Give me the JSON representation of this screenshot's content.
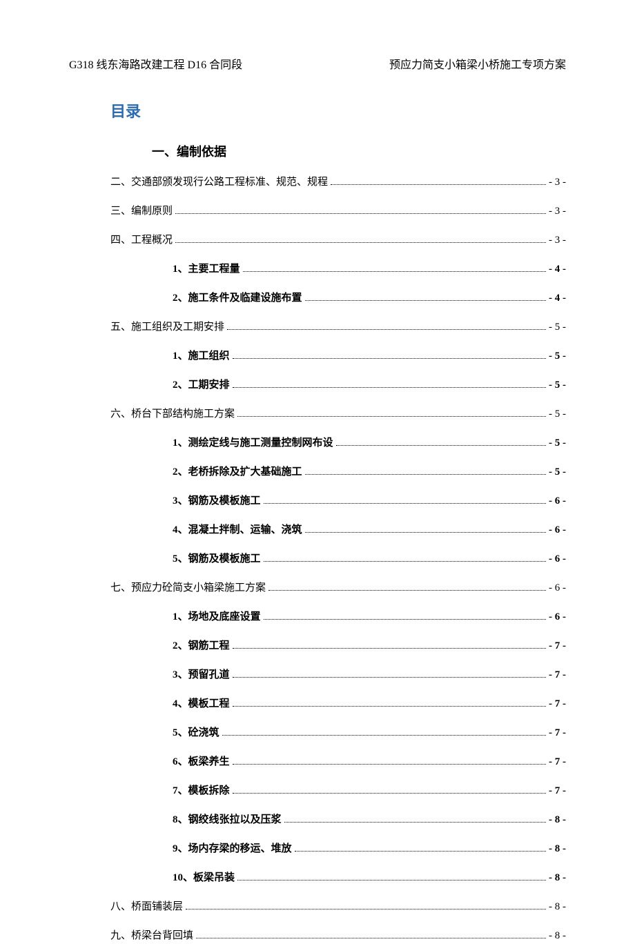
{
  "header": {
    "left": "G318 线东海路改建工程 D16 合同段",
    "right": "预应力简支小箱梁小桥施工专项方案"
  },
  "toc_title": "目录",
  "entries": [
    {
      "level": 0,
      "label": "一、编制依据",
      "page": "",
      "no_dots": true
    },
    {
      "level": 0,
      "label": "二、交通部颁发现行公路工程标准、规范、规程",
      "page": "- 3 -"
    },
    {
      "level": 0,
      "label": "三、编制原则",
      "page": "- 3 -"
    },
    {
      "level": 0,
      "label": "四、工程概况",
      "page": "- 3 -"
    },
    {
      "level": 1,
      "label": "1、主要工程量",
      "page": "- 4 -"
    },
    {
      "level": 1,
      "label": "2、施工条件及临建设施布置",
      "page": "- 4 -"
    },
    {
      "level": 0,
      "label": "五、施工组织及工期安排",
      "page": "- 5 -"
    },
    {
      "level": 1,
      "label": "1、施工组织",
      "page": "- 5 -"
    },
    {
      "level": 1,
      "label": "2、工期安排",
      "page": "- 5 -"
    },
    {
      "level": 0,
      "label": "六、桥台下部结构施工方案",
      "page": "- 5 -"
    },
    {
      "level": 1,
      "label": "1、测绘定线与施工测量控制网布设",
      "page": "- 5 -"
    },
    {
      "level": 1,
      "label": "2、老桥拆除及扩大基础施工",
      "page": "- 5 -"
    },
    {
      "level": 1,
      "label": "3、钢筋及模板施工",
      "page": "- 6 -"
    },
    {
      "level": 1,
      "label": "4、混凝土拌制、运输、浇筑",
      "page": "- 6 -"
    },
    {
      "level": 1,
      "label": "5、钢筋及模板施工",
      "page": "- 6 -"
    },
    {
      "level": 0,
      "label": "七、预应力砼简支小箱梁施工方案",
      "page": "- 6 -"
    },
    {
      "level": 1,
      "label": "1、场地及底座设置",
      "page": "- 6 -"
    },
    {
      "level": 1,
      "label": "2、钢筋工程",
      "page": "- 7 -"
    },
    {
      "level": 1,
      "label": "3、预留孔道",
      "page": "- 7 -"
    },
    {
      "level": 1,
      "label": "4、模板工程",
      "page": "- 7 -"
    },
    {
      "level": 1,
      "label": "5、砼浇筑",
      "page": "- 7 -"
    },
    {
      "level": 1,
      "label": "6、板梁养生",
      "page": "- 7 -"
    },
    {
      "level": 1,
      "label": "7、模板拆除",
      "page": "- 7 -"
    },
    {
      "level": 1,
      "label": "8、钢绞线张拉以及压浆",
      "page": "- 8 -"
    },
    {
      "level": 1,
      "label": "9、场内存梁的移运、堆放",
      "page": "- 8 -"
    },
    {
      "level": 1,
      "label": "10、板梁吊装",
      "page": "- 8 -"
    },
    {
      "level": 0,
      "label": "八、桥面铺装层",
      "page": "- 8 -"
    },
    {
      "level": 0,
      "label": "九、桥梁台背回填",
      "page": "- 8 -"
    }
  ]
}
